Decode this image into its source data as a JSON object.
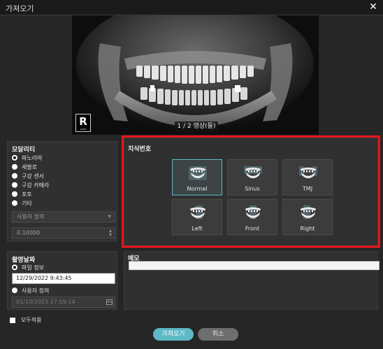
{
  "window": {
    "title": "가져오기",
    "close_icon": "close-icon"
  },
  "preview": {
    "orientation_badge": "R",
    "badge_small": "LOGO",
    "counter": "1 / 2 영상(들)"
  },
  "modality": {
    "title": "모달리티",
    "options": [
      {
        "label": "파노라마",
        "checked": true
      },
      {
        "label": "세팔로",
        "checked": false
      },
      {
        "label": "구강 센서",
        "checked": false
      },
      {
        "label": "구강 카메라",
        "checked": false
      },
      {
        "label": "포토",
        "checked": false
      },
      {
        "label": "기타",
        "checked": false
      }
    ],
    "select_value": "사용자 정의",
    "spin_value": "0.10000"
  },
  "date": {
    "title": "촬영날짜",
    "file_info_label": "파일 정보",
    "file_info_value": "12/29/2022 9:43:45",
    "custom_label": "사용자 정의",
    "custom_value": "01/10/2023 17:59:14"
  },
  "teeth": {
    "title": "치식번호",
    "buttons": [
      {
        "label": "Normal",
        "icon": "jaw-normal-icon",
        "active": true
      },
      {
        "label": "Sinus",
        "icon": "jaw-sinus-icon",
        "active": false
      },
      {
        "label": "TMJ",
        "icon": "jaw-tmj-icon",
        "active": false
      },
      {
        "label": "Left",
        "icon": "jaw-left-icon",
        "active": false
      },
      {
        "label": "Front",
        "icon": "jaw-front-icon",
        "active": false
      },
      {
        "label": "Right",
        "icon": "jaw-right-icon",
        "active": false
      }
    ]
  },
  "memo": {
    "title": "메모",
    "value": ""
  },
  "apply_all": {
    "label": "모두적용",
    "checked": false
  },
  "buttons": {
    "ok": "가져오기",
    "cancel": "취소"
  },
  "colors": {
    "highlight": "#e8141a",
    "accent": "#5cb9c6",
    "background": "#262626"
  }
}
